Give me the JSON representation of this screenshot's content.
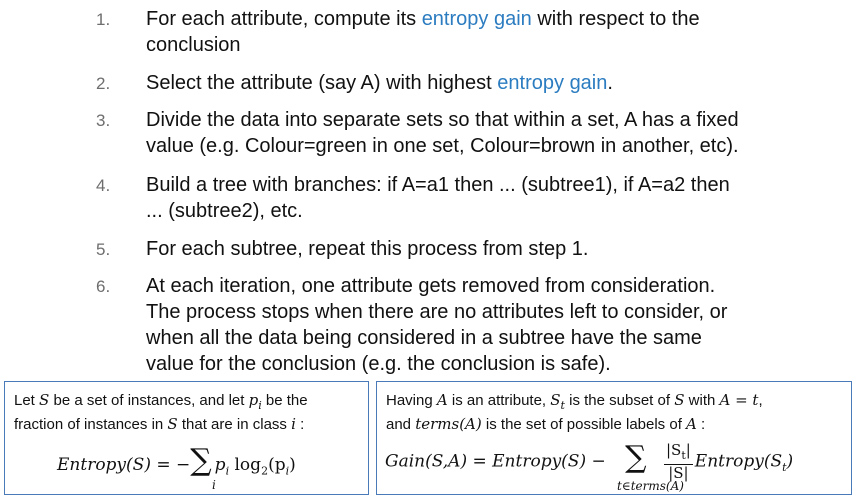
{
  "steps": [
    {
      "num": "1.",
      "pre": "For each attribute, compute its ",
      "hl": "entropy gain",
      "post": " with respect to the",
      "line2": "conclusion"
    },
    {
      "num": "2.",
      "pre": "Select the attribute (say A) with highest ",
      "hl": "entropy gain",
      "post": "."
    },
    {
      "num": "3.",
      "line1": "Divide the data into separate sets so that within a set, A has a fixed",
      "line2": "value (e.g. Colour=green in one set, Colour=brown in another, etc)."
    },
    {
      "num": "4.",
      "line1": "Build a tree with branches: if A=a1 then ... (subtree1), if A=a2 then",
      "line2": "... (subtree2), etc."
    },
    {
      "num": "5.",
      "line1": "For each subtree, repeat this process from step 1."
    },
    {
      "num": "6.",
      "line1": "At each iteration, one attribute gets removed from consideration.",
      "line2": "The process stops when there are no attributes left to consider, or",
      "line3": "when all the data being considered in a subtree have the same",
      "line4": "value for the conclusion (e.g. the conclusion is safe)."
    }
  ],
  "left_box": {
    "t1": "Let ",
    "v_S": "S",
    "t2": " be a set of instances, and let ",
    "v_p": "p",
    "v_i_sub": "i",
    "t3": " be the",
    "t4": "fraction of instances in ",
    "v_S2": "S",
    "t5": " that are in class ",
    "v_i": "i",
    "t6": " :",
    "f_lhs": "Entropy(S)",
    "f_eq": " = −",
    "f_sum": "∑",
    "f_p": "p",
    "f_pi": "i",
    "f_log": " log",
    "f_2": "2",
    "f_arg": "(p",
    "f_argi": "i",
    "f_close": ")",
    "f_under": "i"
  },
  "right_box": {
    "t1": "Having ",
    "v_A": "A",
    "t2": " is an attribute, ",
    "v_S": "S",
    "v_t": "t",
    "t3": " is the subset of ",
    "v_S2": "S",
    "t4": " with ",
    "v_eq": "A = t",
    "t5": ",",
    "t6": "and ",
    "v_terms": "terms(A)",
    "t7": " is the set of possible labels of ",
    "v_A2": "A",
    "t8": " :",
    "f_lhs": "Gain(S,A) = Entropy(S) −",
    "f_sum": "∑",
    "f_num": "|S",
    "f_numt": "t",
    "f_numc": "|",
    "f_den": "|S|",
    "f_rhs": "Entropy(S",
    "f_rhst": "t",
    "f_rhsc": ")",
    "f_under": "t∈terms(A)"
  }
}
